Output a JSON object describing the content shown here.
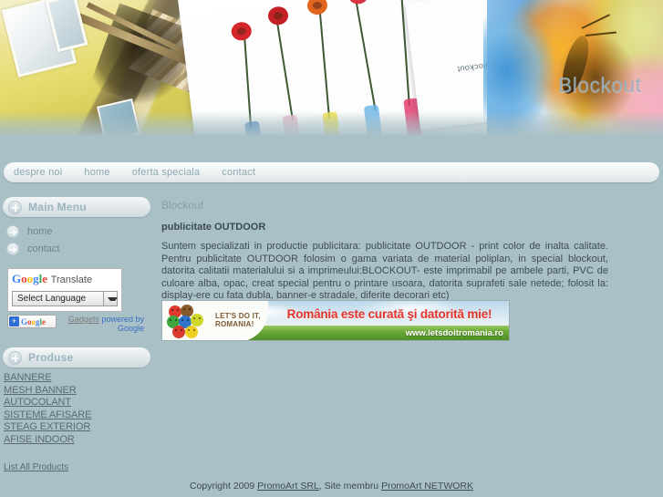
{
  "site": {
    "hero_word": "Blockout",
    "hero_card_word": "blockout"
  },
  "nav": {
    "items": [
      {
        "label": "despre noi"
      },
      {
        "label": "home"
      },
      {
        "label": "oferta speciala"
      },
      {
        "label": "contact"
      }
    ]
  },
  "sidebar": {
    "main_menu": {
      "title": "Main Menu",
      "icon": "plus-circle-icon",
      "items": [
        {
          "label": "home",
          "icon": "arrow-right-icon"
        },
        {
          "label": "contact",
          "icon": "arrow-right-icon"
        }
      ]
    },
    "translate": {
      "brand_g1": "G",
      "brand_g2": "o",
      "brand_g3": "o",
      "brand_g4": "g",
      "brand_g5": "l",
      "brand_g6": "e",
      "brand_suffix": "Translate",
      "selected_language": "Select Language",
      "caret_icon": "chevron-down-icon",
      "badge_plus": "+",
      "badge_word": "Google",
      "gadgets_link": "Gadgets",
      "powered_by": "powered by",
      "powered_by_brand": "Google"
    },
    "produse": {
      "title": "Produse",
      "icon": "plus-circle-icon",
      "items": [
        {
          "label": "BANNERE"
        },
        {
          "label": "MESH BANNER"
        },
        {
          "label": "AUTOCOLANT"
        },
        {
          "label": "SISTEME AFISARE"
        },
        {
          "label": "STEAG EXTERIOR"
        },
        {
          "label": "AFISE INDOOR"
        }
      ],
      "list_all": "List All Products"
    }
  },
  "content": {
    "page_title": "Blockout",
    "article_title": "publicitate OUTDOOR",
    "article_body": "Suntem specializati in productie publicitara: publicitate OUTDOOR - print color de inalta calitate. Pentru publicitate OUTDOOR folosim o gama variata de material poliplan, in special blockout, datorita calitatii materialului si a imprimeului:BLOCKOUT- este imprimabil pe ambele parti, PVC de culoare alba, opac, creat special pentru o printare usoara, datorita suprafeti sale netede; folosit la: display-ere cu fata dubla, banner-e stradale, diferite decorari etc)"
  },
  "banner": {
    "title": "România este curată şi datorită mie!",
    "slogan_line1": "LET'S DO IT,",
    "slogan_line2": "ROMANIA!",
    "url": "www.letsdoitromania.ro"
  },
  "footer": {
    "copyright": "Copyright 2009",
    "company": "PromoArt SRL",
    "separator": ", Site membru",
    "network": "PromoArt NETWORK"
  },
  "colors": {
    "page_bg": "#a9c0c6",
    "nav_text": "#8fa8b2",
    "module_title": "#9cb4bd",
    "body_text": "#404d53",
    "link": "#5c6b72",
    "banner_red": "#e4322b",
    "banner_green": "#5f9e31"
  }
}
